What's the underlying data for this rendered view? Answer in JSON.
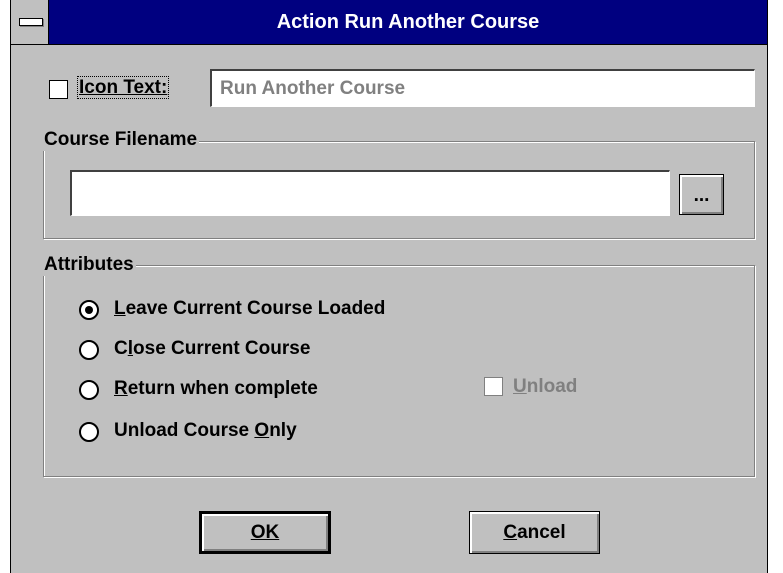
{
  "window": {
    "title": "Action Run Another Course"
  },
  "icon_text": {
    "label": "Icon Text:",
    "value": "Run Another Course",
    "checked": false
  },
  "course_filename": {
    "group_label": "Course Filename",
    "value": "",
    "browse_label": "..."
  },
  "attributes": {
    "group_label": "Attributes",
    "options": [
      {
        "label": "Leave Current Course Loaded",
        "selected": true
      },
      {
        "label": "Close Current Course",
        "selected": false
      },
      {
        "label": "Return when complete",
        "selected": false
      },
      {
        "label": "Unload Course Only",
        "selected": false
      }
    ],
    "unload_checkbox": {
      "label": "Unload",
      "checked": false,
      "enabled": false
    }
  },
  "buttons": {
    "ok": "OK",
    "cancel": "Cancel"
  }
}
